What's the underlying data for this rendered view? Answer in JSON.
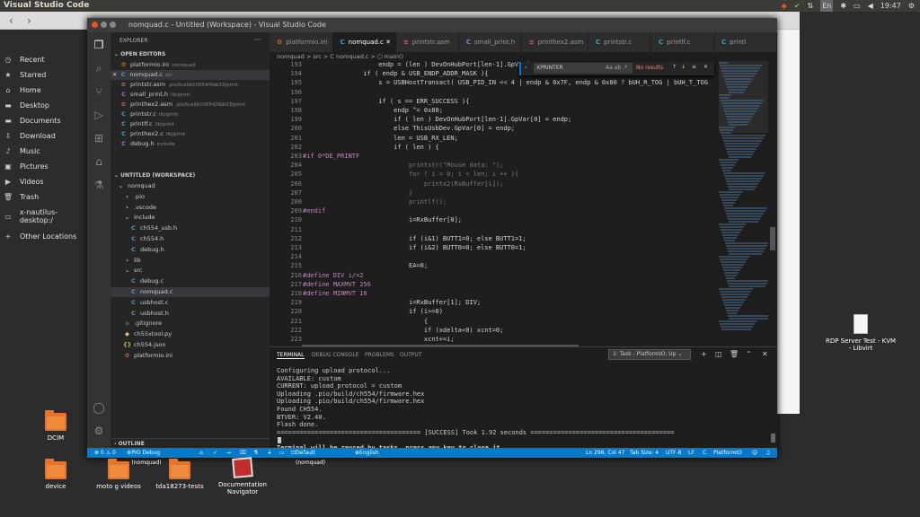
{
  "system": {
    "app_title": "Visual Studio Code",
    "clock": "19:47",
    "tray_lang": "En"
  },
  "nautilus": {
    "sidebar": [
      {
        "label": "Recent",
        "icon": "clock-icon"
      },
      {
        "label": "Starred",
        "icon": "star-icon"
      },
      {
        "label": "Home",
        "icon": "home-icon"
      },
      {
        "label": "Desktop",
        "icon": "folder-icon"
      },
      {
        "label": "Documents",
        "icon": "folder-icon"
      },
      {
        "label": "Download",
        "icon": "download-icon"
      },
      {
        "label": "Music",
        "icon": "music-icon"
      },
      {
        "label": "Pictures",
        "icon": "picture-icon"
      },
      {
        "label": "Videos",
        "icon": "video-icon"
      },
      {
        "label": "Trash",
        "icon": "trash-icon"
      },
      {
        "label": "x-nautilus-desktop:/",
        "icon": "drive-icon"
      },
      {
        "label": "Other Locations",
        "icon": "plus-icon"
      }
    ]
  },
  "vscode": {
    "window_title": "nomquad.c - Untitled (Workspace) - Visual Studio Code",
    "explorer_title": "EXPLORER",
    "open_editors_label": "OPEN EDITORS",
    "open_editors": [
      {
        "name": "platformio.ini",
        "sub": "nomquad",
        "kind": "ini"
      },
      {
        "name": "nomquad.c",
        "sub": "src",
        "kind": "c"
      },
      {
        "name": "printstr.asm",
        "sub": ".pio/build/ch554/libb33/print",
        "kind": "asm"
      },
      {
        "name": "small_print.h",
        "sub": "lib/print",
        "kind": "h"
      },
      {
        "name": "printhex2.asm",
        "sub": ".pio/build/ch554/libb33/print",
        "kind": "asm"
      },
      {
        "name": "printstr.c",
        "sub": "lib/print",
        "kind": "c"
      },
      {
        "name": "printlf.c",
        "sub": "lib/print",
        "kind": "c"
      },
      {
        "name": "printhex2.c",
        "sub": "lib/print",
        "kind": "c"
      },
      {
        "name": "debug.h",
        "sub": "include",
        "kind": "h"
      }
    ],
    "workspace_label": "UNTITLED (WORKSPACE)",
    "tree": [
      {
        "name": "nomquad",
        "kind": "folder-open",
        "indent": 1
      },
      {
        "name": ".pio",
        "kind": "folder",
        "indent": 2
      },
      {
        "name": ".vscode",
        "kind": "folder",
        "indent": 2
      },
      {
        "name": "include",
        "kind": "folder-open",
        "indent": 2
      },
      {
        "name": "ch554_usb.h",
        "kind": "c",
        "indent": 3
      },
      {
        "name": "ch554.h",
        "kind": "c",
        "indent": 3
      },
      {
        "name": "debug.h",
        "kind": "c",
        "indent": 3
      },
      {
        "name": "lib",
        "kind": "folder",
        "indent": 2
      },
      {
        "name": "src",
        "kind": "folder-open",
        "indent": 2
      },
      {
        "name": "debug.c",
        "kind": "c",
        "indent": 3
      },
      {
        "name": "nomquad.c",
        "kind": "c",
        "indent": 3,
        "selected": true
      },
      {
        "name": "usbhost.c",
        "kind": "c",
        "indent": 3
      },
      {
        "name": "usbhost.h",
        "kind": "c",
        "indent": 3
      },
      {
        "name": ".gitignore",
        "kind": "git",
        "indent": 2
      },
      {
        "name": "ch55xtool.py",
        "kind": "py",
        "indent": 2
      },
      {
        "name": "ch554.json",
        "kind": "json",
        "indent": 2
      },
      {
        "name": "platformio.ini",
        "kind": "ini",
        "indent": 2
      }
    ],
    "outline_label": "OUTLINE",
    "tabs": [
      {
        "name": "platformio.ini",
        "kind": "ini"
      },
      {
        "name": "nomquad.c",
        "kind": "c",
        "active": true
      },
      {
        "name": "printstr.asm",
        "kind": "asm"
      },
      {
        "name": "small_print.h",
        "kind": "h"
      },
      {
        "name": "printhex2.asm",
        "kind": "asm"
      },
      {
        "name": "printstr.c",
        "kind": "c"
      },
      {
        "name": "printlf.c",
        "kind": "c"
      },
      {
        "name": "printl",
        "kind": "c"
      }
    ],
    "breadcrumb": "nomquad > src > C nomquad.c > ⬡ main()",
    "find": {
      "value": "XPRINTER",
      "result": "No results",
      "options": "Aa  ab  .*"
    },
    "code": [
      {
        "n": "193",
        "t": "                    endp = (len ) DevOnHubPort[len-1].GpVar[0"
      },
      {
        "n": "194",
        "t": "                if ( endp & USB_ENDP_ADDR_MASK ){"
      },
      {
        "n": "195",
        "t": "                    s = USBHostTransact( USB_PID_IN << 4 | endp & 0x7F, endp & 0x80 ? bUH_R_TOG | bUH_T_TOG"
      },
      {
        "n": "196",
        "t": ""
      },
      {
        "n": "197",
        "t": "                    if ( s == ERR_SUCCESS ){"
      },
      {
        "n": "198",
        "t": "                        endp ^= 0x80;"
      },
      {
        "n": "199",
        "t": "                        if ( len ) DevOnHubPort[len-1].GpVar[0] = endp;"
      },
      {
        "n": "200",
        "t": "                        else ThisUsbDev.GpVar[0] = endp;"
      },
      {
        "n": "201",
        "t": "                        len = USB_RX_LEN;"
      },
      {
        "n": "202",
        "t": "                        if ( len ) {"
      },
      {
        "n": "203",
        "t": "#if 0*DE_PRINTF"
      },
      {
        "n": "204",
        "t": "                            printstr(\"Mouse data: \");"
      },
      {
        "n": "205",
        "t": "                            for ( i = 0; i < len; i ++ ){"
      },
      {
        "n": "206",
        "t": "                                printx2(RxBuffer[i]);"
      },
      {
        "n": "207",
        "t": "                            }"
      },
      {
        "n": "208",
        "t": "                            printlf();"
      },
      {
        "n": "209",
        "t": "#endif"
      },
      {
        "n": "210",
        "t": "                            i=RxBuffer[0];"
      },
      {
        "n": "211",
        "t": ""
      },
      {
        "n": "212",
        "t": "                            if (i&1) BUTT1=0; else BUTT1=1;"
      },
      {
        "n": "213",
        "t": "                            if (i&2) BUTT0=0; else BUTT0=1;"
      },
      {
        "n": "214",
        "t": ""
      },
      {
        "n": "215",
        "t": "                            EA=0;"
      },
      {
        "n": "216",
        "t": "#define DIV i/=2"
      },
      {
        "n": "217",
        "t": "#define MAXMVT 256"
      },
      {
        "n": "218",
        "t": "#define MINMVT 10"
      },
      {
        "n": "219",
        "t": "                            i=RxBuffer[1]; DIV;"
      },
      {
        "n": "220",
        "t": "                            if (i>=0)"
      },
      {
        "n": "221",
        "t": "                                {"
      },
      {
        "n": "222",
        "t": "                                if (xdelta<0) xcnt=0;"
      },
      {
        "n": "223",
        "t": "                                xcnt+=i;"
      }
    ],
    "panel_tabs": [
      "TERMINAL",
      "DEBUG CONSOLE",
      "PROBLEMS",
      "OUTPUT"
    ],
    "terminal_select": "1: Task - PlatformIO: Up",
    "terminal": [
      "Configuring upload protocol...",
      "AVAILABLE: custom",
      "CURRENT: upload_protocol = custom",
      "Uploading .pio/build/ch554/firmware.hex",
      "Uploading .pio/build/ch554/firmware.hex",
      "Found CH554.",
      "BTVER: V2.40.",
      "Flash done.",
      "====================================== [SUCCESS] Took 1.92 seconds ======================================",
      "",
      "Terminal will be reused by tasks, press any key to close it."
    ],
    "status": {
      "problems": "⊗ 0 ⚠ 0",
      "debug": "PIO Debug (nomquad)",
      "env": "Default (nomquad)",
      "lang_en": "English",
      "position": "Ln 296, Col 47",
      "tab_size": "Tab Size: 4",
      "encoding": "UTF-8",
      "eol": "LF",
      "language": "C",
      "platform": "PlatformIO"
    }
  },
  "desktop_icons": [
    {
      "label": "DCIM",
      "kind": "folder"
    },
    {
      "label": "device",
      "kind": "folder"
    },
    {
      "label": "moto g videos",
      "kind": "folder"
    },
    {
      "label": "tda18273-tests",
      "kind": "folder"
    },
    {
      "label": "Documentation Navigator",
      "kind": "app"
    },
    {
      "label": "RDP Server Test - KVM - Libvirt",
      "kind": "doc"
    }
  ]
}
